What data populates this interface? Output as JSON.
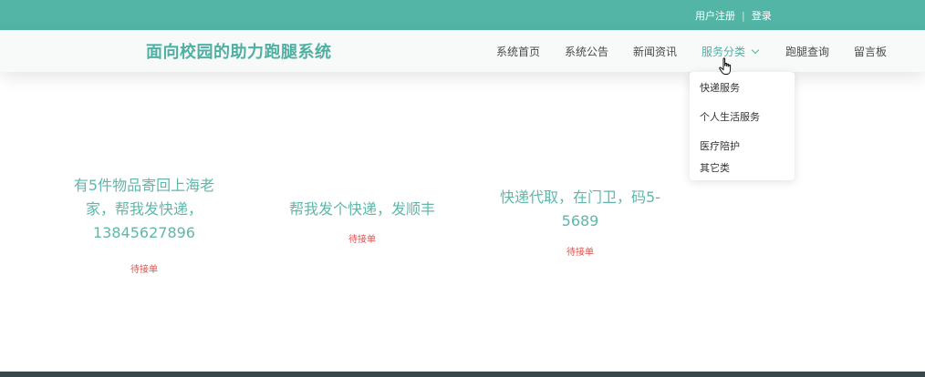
{
  "topbar": {
    "register_label": "用户注册",
    "separator": "|",
    "login_label": "登录",
    "color": "#52b5a6"
  },
  "header": {
    "site_title": "面向校园的助力跑腿系统",
    "nav": [
      {
        "label": "系统首页"
      },
      {
        "label": "系统公告"
      },
      {
        "label": "新闻资讯"
      },
      {
        "label": "服务分类",
        "active": true
      },
      {
        "label": "跑腿查询"
      },
      {
        "label": "留言板"
      }
    ]
  },
  "dropdown": {
    "items": [
      {
        "label": "快递服务"
      },
      {
        "label": "个人生活服务"
      },
      {
        "label": "医疗陪护"
      },
      {
        "label": "其它类"
      }
    ]
  },
  "cards": [
    {
      "title": "有5件物品寄回上海老家，帮我发快递，13845627896",
      "status": "待接单"
    },
    {
      "title": "帮我发个快递，发顺丰",
      "status": "待接单"
    },
    {
      "title": "快递代取，在门卫，码5-5689",
      "status": "待接单"
    }
  ],
  "colors": {
    "accent": "#4fb0a2",
    "status": "#d9534f",
    "footer": "#39474a"
  }
}
